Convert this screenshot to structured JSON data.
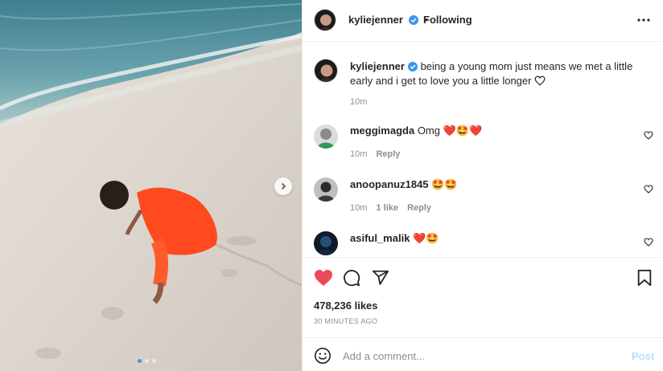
{
  "post": {
    "author": "kyliejenner",
    "following_label": "Following",
    "caption": "being a young mom just means we met a little early and i get to love you a little longer",
    "caption_time": "10m",
    "likes": "478,236 likes",
    "posted_ago": "30 MINUTES AGO",
    "carousel": {
      "count": 3,
      "active": 1
    }
  },
  "comments": [
    {
      "user": "meggimagda",
      "text": "Omg ❤️🤩❤️",
      "time": "10m",
      "likes": "",
      "reply_label": "Reply"
    },
    {
      "user": "anoopanuz1845",
      "text": "🤩🤩",
      "time": "10m",
      "likes": "1 like",
      "reply_label": "Reply"
    },
    {
      "user": "asiful_malik",
      "text": "❤️🤩",
      "time": "",
      "likes": "",
      "reply_label": ""
    }
  ],
  "composer": {
    "placeholder": "Add a comment...",
    "post_label": "Post"
  },
  "icons": {
    "verified": "verified-badge-icon",
    "more": "more-options-icon",
    "like": "heart-filled-icon",
    "comment": "comment-icon",
    "share": "share-icon",
    "save": "bookmark-icon",
    "emoji": "emoji-icon",
    "next": "chevron-right-icon"
  },
  "colors": {
    "like": "#ed4956",
    "link": "#0095f6",
    "post_disabled": "#b2dffc",
    "dress": "#ff4a1f"
  }
}
